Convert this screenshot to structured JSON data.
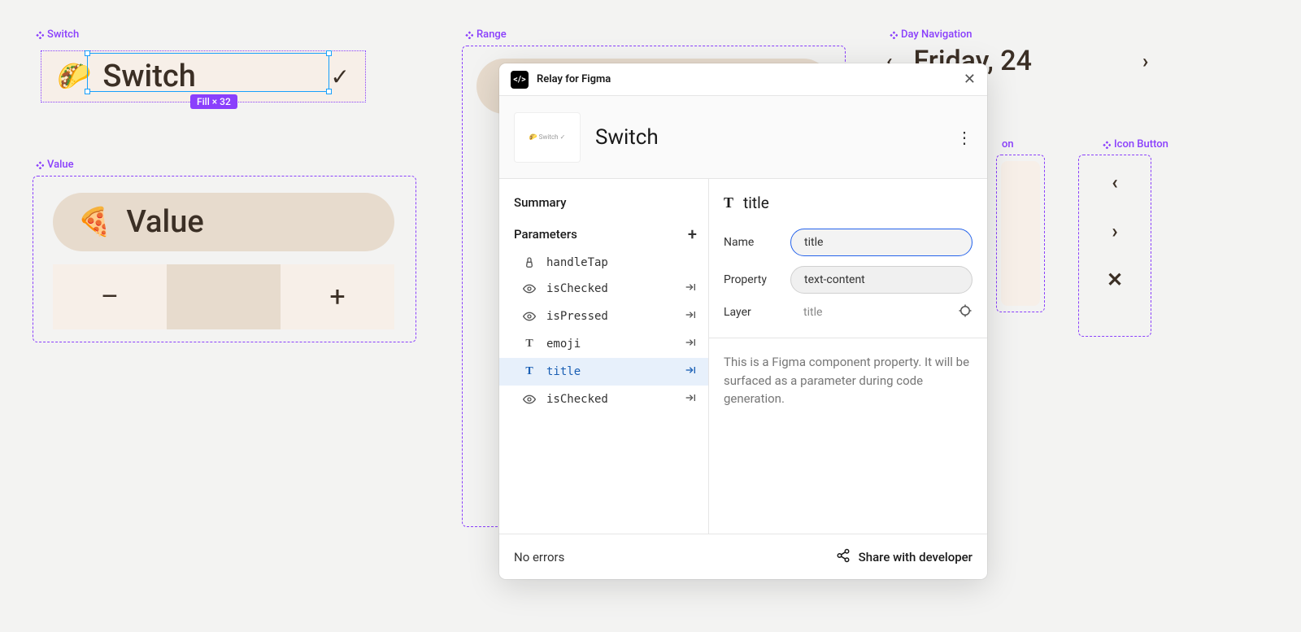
{
  "canvas": {
    "switch": {
      "component_label": "Switch",
      "emoji": "🌮",
      "title": "Switch",
      "selection_badge": "Fill × 32"
    },
    "value": {
      "component_label": "Value",
      "emoji": "🍕",
      "title": "Value",
      "minus": "–",
      "plus": "+"
    },
    "range": {
      "component_label": "Range"
    },
    "day_nav": {
      "component_label": "Day Navigation",
      "label": "Friday, 24"
    },
    "icon_button_top": {
      "component_label": "on"
    },
    "icon_button": {
      "component_label": "Icon Button"
    }
  },
  "panel": {
    "app_title": "Relay for Figma",
    "logo_text": "</>",
    "header": {
      "thumb_text": "🌮 Switch ✓",
      "name": "Switch"
    },
    "left": {
      "summary": "Summary",
      "parameters_label": "Parameters",
      "params": [
        {
          "icon": "tap",
          "name": "handleTap",
          "arrow": false
        },
        {
          "icon": "eye",
          "name": "isChecked",
          "arrow": true
        },
        {
          "icon": "eye",
          "name": "isPressed",
          "arrow": true
        },
        {
          "icon": "text",
          "name": "emoji",
          "arrow": true
        },
        {
          "icon": "text",
          "name": "title",
          "arrow": true,
          "selected": true
        },
        {
          "icon": "eye",
          "name": "isChecked",
          "arrow": true
        }
      ]
    },
    "right": {
      "title_label": "title",
      "name_label": "Name",
      "name_value": "title",
      "property_label": "Property",
      "property_value": "text-content",
      "layer_label": "Layer",
      "layer_value": "title",
      "description": "This is a Figma component property. It will be surfaced as a parameter during code generation."
    },
    "footer": {
      "errors": "No errors",
      "share": "Share with developer"
    }
  }
}
